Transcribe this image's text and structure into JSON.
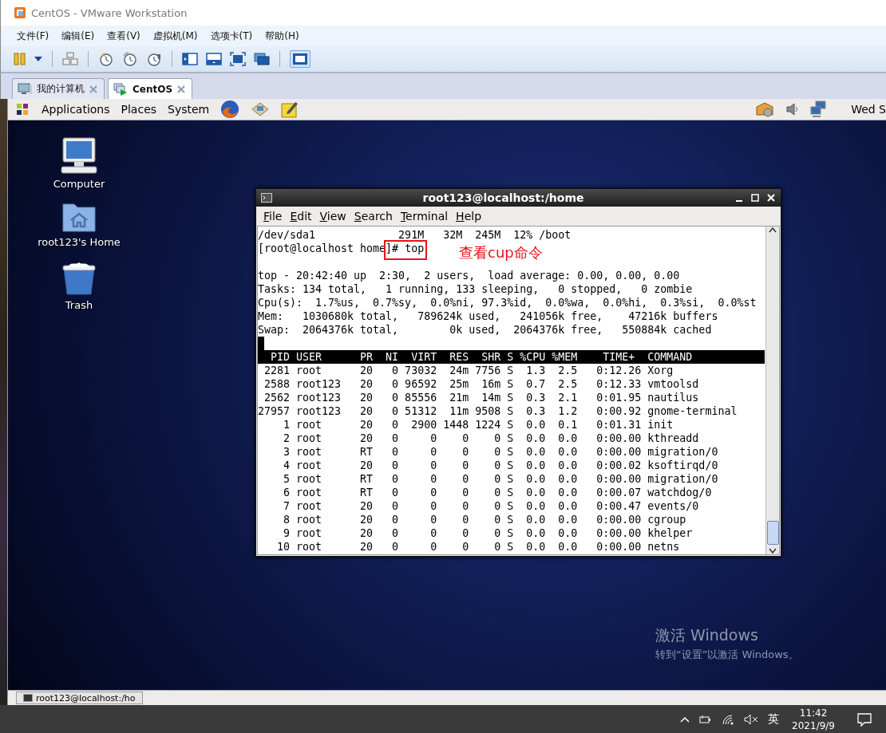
{
  "window": {
    "title": "CentOS - VMware Workstation"
  },
  "menu": [
    "文件(F)",
    "编辑(E)",
    "查看(V)",
    "虚拟机(M)",
    "选项卡(T)",
    "帮助(H)"
  ],
  "tabs": [
    {
      "label": "我的计算机",
      "selected": false
    },
    {
      "label": "CentOS",
      "selected": true
    }
  ],
  "guest": {
    "panel": {
      "menus": [
        "Applications",
        "Places",
        "System"
      ],
      "clock": "Wed S"
    },
    "desktop_icons": [
      {
        "label": "Computer",
        "kind": "computer"
      },
      {
        "label": "root123's Home",
        "kind": "home"
      },
      {
        "label": "Trash",
        "kind": "trash"
      }
    ],
    "terminal": {
      "title": "root123@localhost:/home",
      "menus": [
        "File",
        "Edit",
        "View",
        "Search",
        "Terminal",
        "Help"
      ],
      "lines": [
        {
          "kind": "text",
          "text": "/dev/sda1             291M   32M  245M  12% /boot"
        },
        {
          "kind": "marked",
          "text": "[root@localhost home",
          "marked": "]# top"
        },
        {
          "kind": "blank"
        },
        {
          "kind": "text",
          "text": "top - 20:42:40 up  2:30,  2 users,  load average: 0.00, 0.00, 0.00"
        },
        {
          "kind": "text",
          "text": "Tasks: 134 total,   1 running, 133 sleeping,   0 stopped,   0 zombie"
        },
        {
          "kind": "text",
          "text": "Cpu(s):  1.7%us,  0.7%sy,  0.0%ni, 97.3%id,  0.0%wa,  0.0%hi,  0.3%si,  0.0%st"
        },
        {
          "kind": "text",
          "text": "Mem:   1030680k total,   789624k used,   241056k free,    47216k buffers"
        },
        {
          "kind": "text",
          "text": "Swap:  2064376k total,        0k used,  2064376k free,   550884k cached"
        },
        {
          "kind": "cursor"
        },
        {
          "kind": "header",
          "text": "  PID USER      PR  NI  VIRT  RES  SHR S %CPU %MEM    TIME+  COMMAND"
        },
        {
          "kind": "text",
          "text": " 2281 root      20   0 73032  24m 7756 S  1.3  2.5   0:12.26 Xorg"
        },
        {
          "kind": "text",
          "text": " 2588 root123   20   0 96592  25m  16m S  0.7  2.5   0:12.33 vmtoolsd"
        },
        {
          "kind": "text",
          "text": " 2562 root123   20   0 85556  21m  14m S  0.3  2.1   0:01.95 nautilus"
        },
        {
          "kind": "text",
          "text": "27957 root123   20   0 51312  11m 9508 S  0.3  1.2   0:00.92 gnome-terminal"
        },
        {
          "kind": "text",
          "text": "    1 root      20   0  2900 1448 1224 S  0.0  0.1   0:01.31 init"
        },
        {
          "kind": "text",
          "text": "    2 root      20   0     0    0    0 S  0.0  0.0   0:00.00 kthreadd"
        },
        {
          "kind": "text",
          "text": "    3 root      RT   0     0    0    0 S  0.0  0.0   0:00.00 migration/0"
        },
        {
          "kind": "text",
          "text": "    4 root      20   0     0    0    0 S  0.0  0.0   0:00.02 ksoftirqd/0"
        },
        {
          "kind": "text",
          "text": "    5 root      RT   0     0    0    0 S  0.0  0.0   0:00.00 migration/0"
        },
        {
          "kind": "text",
          "text": "    6 root      RT   0     0    0    0 S  0.0  0.0   0:00.07 watchdog/0"
        },
        {
          "kind": "text",
          "text": "    7 root      20   0     0    0    0 S  0.0  0.0   0:00.47 events/0"
        },
        {
          "kind": "text",
          "text": "    8 root      20   0     0    0    0 S  0.0  0.0   0:00.00 cgroup"
        },
        {
          "kind": "text",
          "text": "    9 root      20   0     0    0    0 S  0.0  0.0   0:00.00 khelper"
        },
        {
          "kind": "text",
          "text": "   10 root      20   0     0    0    0 S  0.0  0.0   0:00.00 netns"
        }
      ],
      "annotation": "查看cup命令"
    },
    "taskbar_items": [
      "root123@localhost:/ho"
    ]
  },
  "activation_notice": {
    "title": "激活 Windows",
    "message": "转到“设置”以激活 Windows。"
  },
  "host_taskbar": {
    "ime": "英",
    "time": "11:42",
    "date": "2021/9/9"
  }
}
